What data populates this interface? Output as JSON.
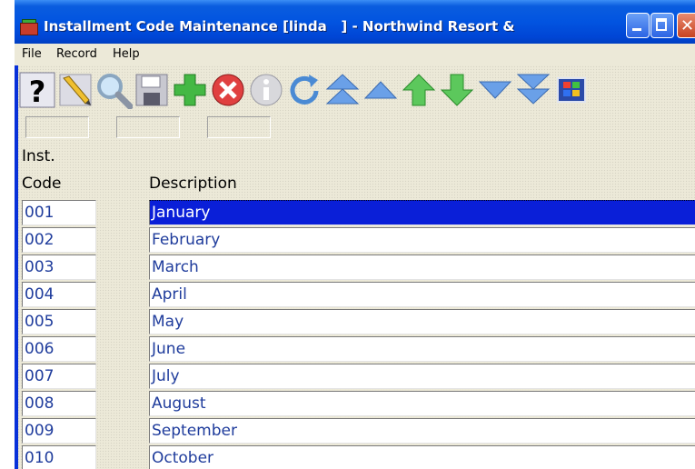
{
  "window": {
    "title": "Installment Code Maintenance [linda   ] - Northwind Resort &"
  },
  "menu": [
    {
      "label": "File"
    },
    {
      "label": "Record"
    },
    {
      "label": "Help"
    }
  ],
  "toolbar": [
    {
      "icon": "help-icon"
    },
    {
      "icon": "edit-pencil-icon"
    },
    {
      "icon": "search-magnifier-icon"
    },
    {
      "icon": "save-disk-icon"
    },
    {
      "icon": "add-plus-icon"
    },
    {
      "icon": "delete-x-icon"
    },
    {
      "icon": "info-icon"
    },
    {
      "icon": "refresh-icon"
    },
    {
      "icon": "first-record-icon"
    },
    {
      "icon": "previous-page-icon"
    },
    {
      "icon": "previous-record-icon"
    },
    {
      "icon": "next-record-icon"
    },
    {
      "icon": "next-page-icon"
    },
    {
      "icon": "last-record-icon"
    },
    {
      "icon": "windows-logo-icon"
    }
  ],
  "columns": {
    "code_line1": "Inst.",
    "code_line2": "Code",
    "description": "Description"
  },
  "rows": [
    {
      "code": "001",
      "description": "January"
    },
    {
      "code": "002",
      "description": "February"
    },
    {
      "code": "003",
      "description": "March"
    },
    {
      "code": "004",
      "description": "April"
    },
    {
      "code": "005",
      "description": "May"
    },
    {
      "code": "006",
      "description": "June"
    },
    {
      "code": "007",
      "description": "July"
    },
    {
      "code": "008",
      "description": "August"
    },
    {
      "code": "009",
      "description": "September"
    },
    {
      "code": "010",
      "description": "October"
    }
  ],
  "selected_row": 0,
  "colors": {
    "title_bar": "#0254e0",
    "selection": "#0a1fd8",
    "cell_text": "#1f3c9c"
  }
}
